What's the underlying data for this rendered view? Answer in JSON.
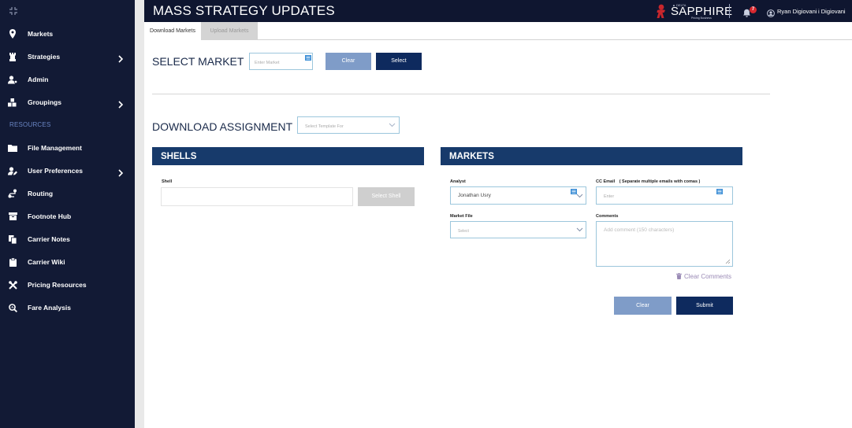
{
  "sidebar": {
    "items": [
      {
        "label": "Markets",
        "icon": "location-pin-icon",
        "has_submenu": false
      },
      {
        "label": "Strategies",
        "icon": "chess-rook-icon",
        "has_submenu": true
      },
      {
        "label": "Admin",
        "icon": "user-cog-icon",
        "has_submenu": false
      },
      {
        "label": "Groupings",
        "icon": "cubes-icon",
        "has_submenu": true
      }
    ],
    "section_title": "RESOURCES",
    "resource_items": [
      {
        "label": "File Management",
        "icon": "folder-icon",
        "has_submenu": false
      },
      {
        "label": "User Preferences",
        "icon": "user-edit-icon",
        "has_submenu": true
      },
      {
        "label": "Routing",
        "icon": "route-icon",
        "has_submenu": false
      },
      {
        "label": "Footnote Hub",
        "icon": "archive-box-icon",
        "has_submenu": false
      },
      {
        "label": "Carrier Notes",
        "icon": "copy-icon",
        "has_submenu": false
      },
      {
        "label": "Carrier Wiki",
        "icon": "clipboard-icon",
        "has_submenu": false
      },
      {
        "label": "Pricing Resources",
        "icon": "tools-icon",
        "has_submenu": false
      },
      {
        "label": "Fare Analysis",
        "icon": "search-chart-icon",
        "has_submenu": false
      }
    ]
  },
  "header": {
    "title": "MASS STRATEGY UPDATES",
    "brand": {
      "small": "▲ DELTA",
      "name": "SAPPHIRE",
      "sub": "Pricing Business"
    },
    "notification_count": "7",
    "user_name": "Ryan Digiovani",
    "user_name_secondary": "i Digiovani"
  },
  "tabs": [
    {
      "label": "Download Markets",
      "active": true
    },
    {
      "label": "Upload Markets",
      "active": false
    }
  ],
  "select_market": {
    "heading": "SELECT MARKET",
    "input_placeholder": "Enter Market",
    "clear_label": "Clear",
    "select_label": "Select"
  },
  "download_assignment": {
    "heading": "DOWNLOAD ASSIGNMENT",
    "template_placeholder": "Select Template For"
  },
  "shells": {
    "title": "SHELLS",
    "shell_label": "Shell",
    "shell_value": "",
    "select_shell_label": "Select Shell"
  },
  "markets": {
    "title": "MARKETS",
    "analyst_label": "Analyst",
    "analyst_value": "Jonathan Usry",
    "cc_label": "CC Email",
    "cc_hint": "( Separate multiple emails with comas )",
    "cc_placeholder": "Enter",
    "market_file_label": "Market File",
    "market_file_placeholder": "Select",
    "comments_label": "Comments",
    "comments_placeholder": "Add comment (150 characters)",
    "clear_comments_label": "Clear Comments",
    "clear_label": "Clear",
    "submit_label": "Submit"
  },
  "colors": {
    "sidebar_bg": "#121a35",
    "header_bg": "#0f1630",
    "section_bar": "#173a6b",
    "primary_button": "#0e2a5e",
    "secondary_button": "#7f9cc8",
    "accent_red": "#d7282f"
  }
}
